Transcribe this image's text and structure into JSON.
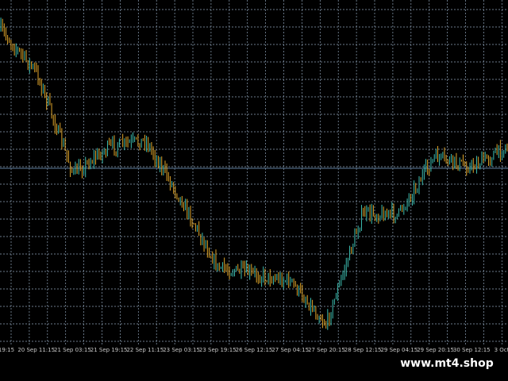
{
  "chart": {
    "background": "#000000",
    "grid_color": "#8fa3b8",
    "candle_colors": {
      "up": "#3cbdb0",
      "down": "#e0a52a"
    },
    "price_line_color": "#5f7f9f",
    "time_labels": [
      "19:15",
      "20 Sep 11:15",
      "21 Sep 03:15",
      "21 Sep 19:15",
      "22 Sep 11:15",
      "23 Sep 03:15",
      "23 Sep 19:15",
      "26 Sep 12:15",
      "27 Sep 04:15",
      "27 Sep 20:15",
      "28 Sep 12:15",
      "29 Sep 04:15",
      "29 Sep 20:15",
      "30 Sep 12:15",
      "3 Oct"
    ]
  },
  "chart_data": {
    "type": "line",
    "x": [
      "19:15",
      "20 Sep 11:15",
      "21 Sep 03:15",
      "21 Sep 19:15",
      "22 Sep 11:15",
      "23 Sep 03:15",
      "23 Sep 19:15",
      "26 Sep 12:15",
      "27 Sep 04:15",
      "27 Sep 20:15",
      "28 Sep 12:15",
      "29 Sep 04:15",
      "29 Sep 20:15",
      "30 Sep 12:15",
      "3 Oct"
    ],
    "series": [
      {
        "values": [
          0.93,
          0.8,
          0.5,
          0.58,
          0.6,
          0.42,
          0.22,
          0.2,
          0.18,
          0.05,
          0.38,
          0.38,
          0.55,
          0.52,
          0.58
        ]
      }
    ],
    "grid": true,
    "axis_position": "bottom"
  },
  "watermark": {
    "text": "www.mt4.shop"
  }
}
